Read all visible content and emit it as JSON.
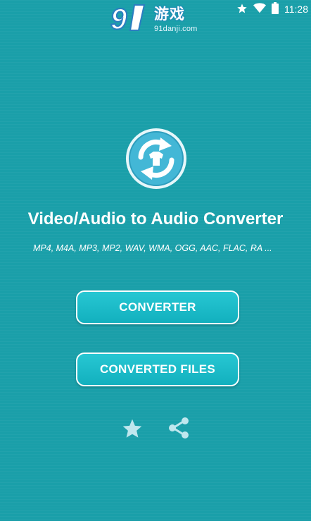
{
  "status_bar": {
    "time": "11:28"
  },
  "watermark": {
    "brand": "游戏",
    "url": "91danji.com",
    "number": "9"
  },
  "app": {
    "title": "Video/Audio to Audio Converter",
    "formats": "MP4, M4A, MP3, MP2, WAV, WMA, OGG, AAC, FLAC, RA ..."
  },
  "buttons": {
    "converter": "CONVERTER",
    "converted_files": "CONVERTED FILES"
  },
  "colors": {
    "background": "#1a9fa9",
    "button": "#1fbcc8",
    "logo_bg": "#3db3d1"
  }
}
